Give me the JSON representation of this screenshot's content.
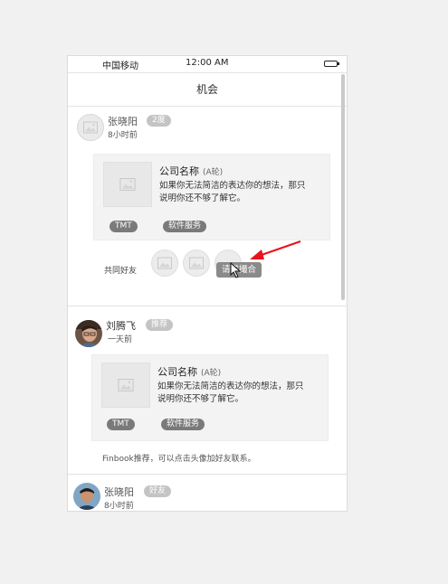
{
  "status_bar": {
    "carrier": "中国移动",
    "time": "12:00 AM",
    "battery_level": 1.0
  },
  "nav": {
    "title": "机会"
  },
  "feed": [
    {
      "user_name": "张晓阳",
      "badge": "2度",
      "time": "8小时前",
      "company": {
        "name": "公司名称",
        "round": "(A轮)",
        "description": "如果你无法简洁的表达你的想法，那只说明你还不够了解它。",
        "tags": [
          "TMT",
          "软件服务"
        ]
      },
      "mutual_label": "共同好友",
      "cta_label": "请求撮合"
    },
    {
      "user_name": "刘腾飞",
      "badge": "推荐",
      "time": "一天前",
      "company": {
        "name": "公司名称",
        "round": "(A轮)",
        "description": "如果你无法简洁的表达你的想法，那只说明你还不够了解它。",
        "tags": [
          "TMT",
          "软件服务"
        ]
      },
      "note": "Finbook推荐，可以点击头像加好友联系。"
    },
    {
      "user_name": "张晓阳",
      "badge": "好友",
      "time": "8小时前"
    }
  ],
  "colors": {
    "annotation_arrow": "#e8141c",
    "tag_bg": "#7a7a7a",
    "badge_bg": "#c4c4c4"
  }
}
